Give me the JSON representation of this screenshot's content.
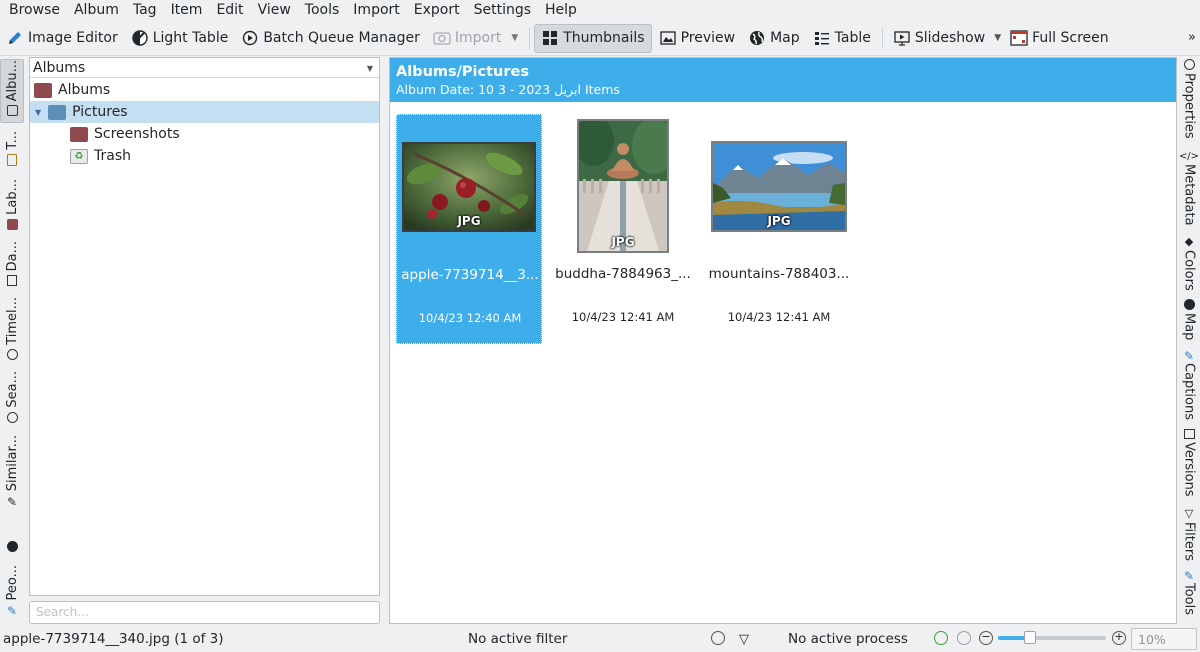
{
  "menu": [
    "Browse",
    "Album",
    "Tag",
    "Item",
    "Edit",
    "View",
    "Tools",
    "Import",
    "Export",
    "Settings",
    "Help"
  ],
  "toolbar": {
    "image_editor": "Image Editor",
    "light_table": "Light Table",
    "batch_queue": "Batch Queue Manager",
    "import": "Import",
    "thumbnails": "Thumbnails",
    "preview": "Preview",
    "map": "Map",
    "table": "Table",
    "slideshow": "Slideshow",
    "full_screen": "Full Screen"
  },
  "left_tabs": [
    "Albu...",
    "T...",
    "Lab...",
    "Da...",
    "Timel...",
    "Sea...",
    "Similar...",
    "Peo..."
  ],
  "right_tabs": [
    "Properties",
    "Metadata",
    "Colors",
    "Map",
    "Captions",
    "Versions",
    "Filters",
    "Tools"
  ],
  "album_panel": {
    "combo_value": "Albums",
    "tree": [
      {
        "label": "Albums",
        "level": 0,
        "selected": false
      },
      {
        "label": "Pictures",
        "level": 1,
        "selected": true
      },
      {
        "label": "Screenshots",
        "level": 2,
        "selected": false
      },
      {
        "label": "Trash",
        "level": 2,
        "selected": false
      }
    ],
    "search_placeholder": "Search..."
  },
  "header": {
    "title": "Albums/Pictures",
    "subtitle": "Album Date: 10 3 - 2023 ابريل  Items"
  },
  "items": [
    {
      "badge": "JPG",
      "name": "apple-7739714__3...",
      "date": "10/4/23 12:40 AM",
      "selected": true
    },
    {
      "badge": "JPG",
      "name": "buddha-7884963_...",
      "date": "10/4/23 12:41 AM",
      "selected": false
    },
    {
      "badge": "JPG",
      "name": "mountains-788403...",
      "date": "10/4/23 12:41 AM",
      "selected": false
    }
  ],
  "status": {
    "file": "apple-7739714__340.jpg (1 of 3)",
    "filter": "No active filter",
    "process": "No active process",
    "zoom": "10%",
    "zoom_fraction": 0.3
  },
  "colors": {
    "accent": "#3daee9",
    "selection": "#c4def2",
    "folder_red": "#8e4a4e",
    "folder_blue": "#5a8fb8"
  }
}
